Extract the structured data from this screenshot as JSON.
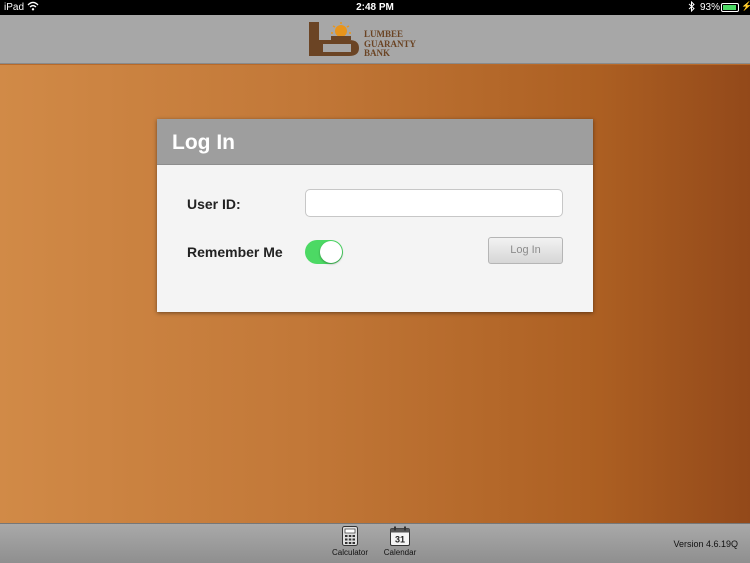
{
  "status_bar": {
    "carrier": "iPad",
    "wifi_icon": "wifi-icon",
    "time": "2:48 PM",
    "bluetooth_icon": "bluetooth-icon",
    "battery_percent": "93%",
    "battery_level": 0.93
  },
  "header": {
    "logo": {
      "line1": "LUMBEE",
      "line2": "GUARANTY",
      "line3": "BANK",
      "brand_color": "#6b4424",
      "sun_color": "#e8951c"
    }
  },
  "login": {
    "title": "Log In",
    "user_id_label": "User ID:",
    "user_id_value": "",
    "remember_label": "Remember Me",
    "remember_on": true,
    "button_label": "Log In"
  },
  "bottom_bar": {
    "items": [
      {
        "label": "Calculator",
        "icon": "calculator-icon"
      },
      {
        "label": "Calendar",
        "icon": "calendar-icon",
        "day": "31"
      }
    ],
    "version": "Version 4.6.19Q"
  },
  "colors": {
    "header_gray": "#a7a7a7",
    "toggle_green": "#4cd964",
    "background_orange": "#c27838"
  }
}
